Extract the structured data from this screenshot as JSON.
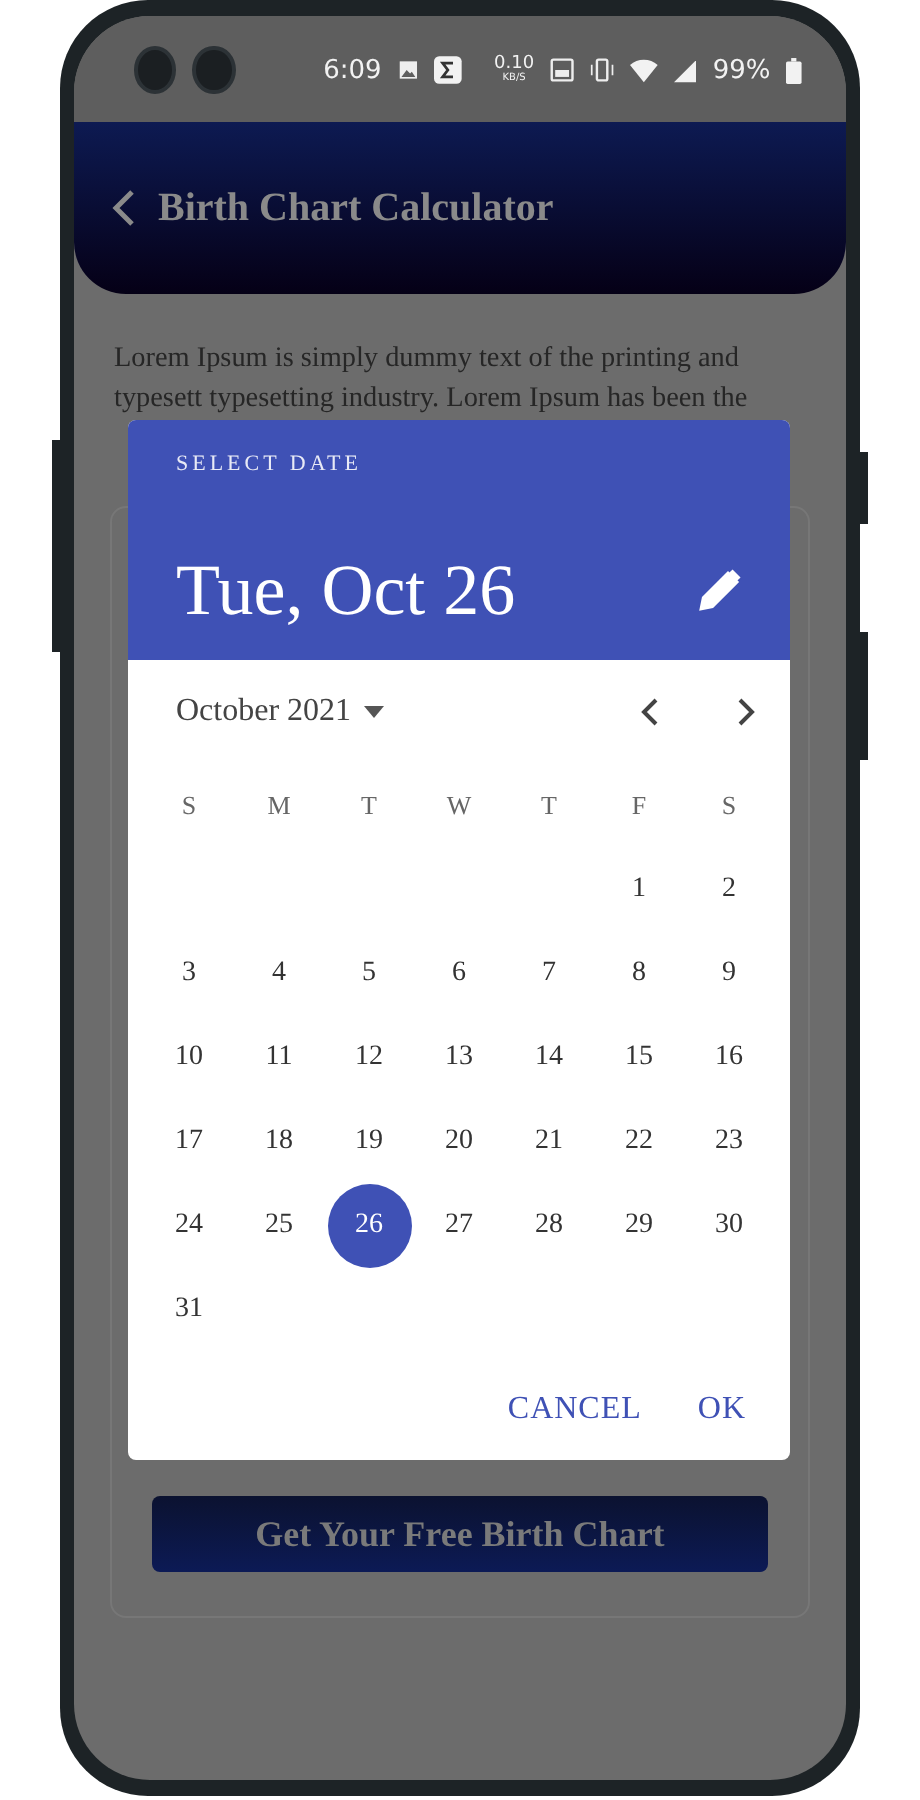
{
  "status_bar": {
    "time": "6:09",
    "speed_value": "0.10",
    "speed_unit": "KB/S",
    "battery": "99%"
  },
  "app_bar": {
    "title": "Birth Chart Calculator"
  },
  "intro": "Lorem Ipsum is simply dummy text of the printing and typesett typesetting industry. Lorem Ipsum has been the",
  "submit_button": "Get Your Free Birth Chart",
  "dialog": {
    "heading": "SELECT DATE",
    "date": "Tue, Oct 26",
    "month": "October 2021",
    "weekdays": [
      "S",
      "M",
      "T",
      "W",
      "T",
      "F",
      "S"
    ],
    "weeks": [
      [
        {
          "day": "1",
          "selected": false
        },
        {
          "day": "2",
          "selected": false
        }
      ],
      [
        {
          "day": "3",
          "selected": false
        },
        {
          "day": "4",
          "selected": false
        },
        {
          "day": "5",
          "selected": false
        },
        {
          "day": "6",
          "selected": false
        },
        {
          "day": "7",
          "selected": false
        },
        {
          "day": "8",
          "selected": false
        },
        {
          "day": "9",
          "selected": false
        }
      ],
      [
        {
          "day": "10",
          "selected": false
        },
        {
          "day": "11",
          "selected": false
        },
        {
          "day": "12",
          "selected": false
        },
        {
          "day": "13",
          "selected": false
        },
        {
          "day": "14",
          "selected": false
        },
        {
          "day": "15",
          "selected": false
        },
        {
          "day": "16",
          "selected": false
        }
      ],
      [
        {
          "day": "17",
          "selected": false
        },
        {
          "day": "18",
          "selected": false
        },
        {
          "day": "19",
          "selected": false
        },
        {
          "day": "20",
          "selected": false
        },
        {
          "day": "21",
          "selected": false
        },
        {
          "day": "22",
          "selected": false
        },
        {
          "day": "23",
          "selected": false
        }
      ],
      [
        {
          "day": "24",
          "selected": false
        },
        {
          "day": "25",
          "selected": false
        },
        {
          "day": "26",
          "selected": true
        },
        {
          "day": "27",
          "selected": false
        },
        {
          "day": "28",
          "selected": false
        },
        {
          "day": "29",
          "selected": false
        },
        {
          "day": "30",
          "selected": false
        }
      ],
      [
        {
          "day": "31",
          "selected": false
        }
      ]
    ],
    "buttons": [
      "CANCEL",
      "OK"
    ]
  }
}
